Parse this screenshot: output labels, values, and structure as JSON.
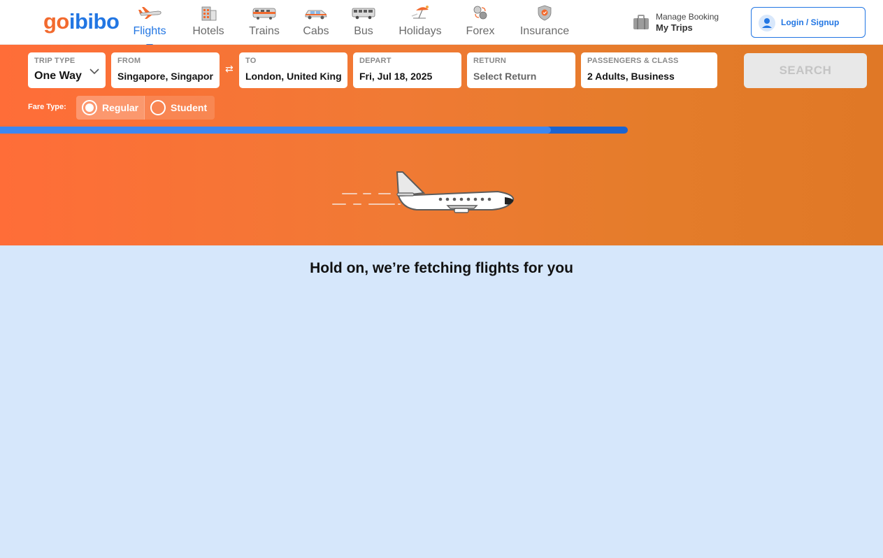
{
  "brand": {
    "go": "go",
    "ibibo": "ibibo"
  },
  "nav": {
    "items": [
      {
        "label": "Flights",
        "icon": "flight-icon",
        "active": true
      },
      {
        "label": "Hotels",
        "icon": "hotel-icon",
        "active": false
      },
      {
        "label": "Trains",
        "icon": "train-icon",
        "active": false
      },
      {
        "label": "Cabs",
        "icon": "cab-icon",
        "active": false
      },
      {
        "label": "Bus",
        "icon": "bus-icon",
        "active": false
      },
      {
        "label": "Holidays",
        "icon": "holiday-icon",
        "active": false
      },
      {
        "label": "Forex",
        "icon": "forex-icon",
        "active": false
      },
      {
        "label": "Insurance",
        "icon": "insurance-icon",
        "active": false
      }
    ]
  },
  "manage_booking": {
    "top": "Manage Booking",
    "bottom": "My Trips",
    "icon": "suitcase-icon"
  },
  "login": {
    "label": "Login / Signup",
    "icon": "user-icon"
  },
  "search": {
    "trip_type": {
      "label": "TRIP TYPE",
      "value": "One Way"
    },
    "from": {
      "label": "FROM",
      "value": "Singapore, Singapor"
    },
    "to": {
      "label": "TO",
      "value": "London, United King"
    },
    "depart": {
      "label": "DEPART",
      "value": "Fri, Jul 18, 2025"
    },
    "return": {
      "label": "RETURN",
      "value": "Select Return"
    },
    "passengers": {
      "label": "PASSENGERS & CLASS",
      "value": "2 Adults, Business"
    },
    "button": "SEARCH",
    "swap_icon": "swap-icon"
  },
  "fare_type": {
    "label": "Fare Type:",
    "options": [
      {
        "label": "Regular",
        "selected": true
      },
      {
        "label": "Student",
        "selected": false
      }
    ]
  },
  "progress": {
    "percent": 87.7
  },
  "loading": {
    "message": "Hold on, we’re fetching flights for you"
  },
  "colors": {
    "brand_orange": "#f26a2e",
    "brand_blue": "#2276e3",
    "band_start": "#ff6d38",
    "band_end": "#e07826",
    "page_bg": "#d6e7fb"
  }
}
